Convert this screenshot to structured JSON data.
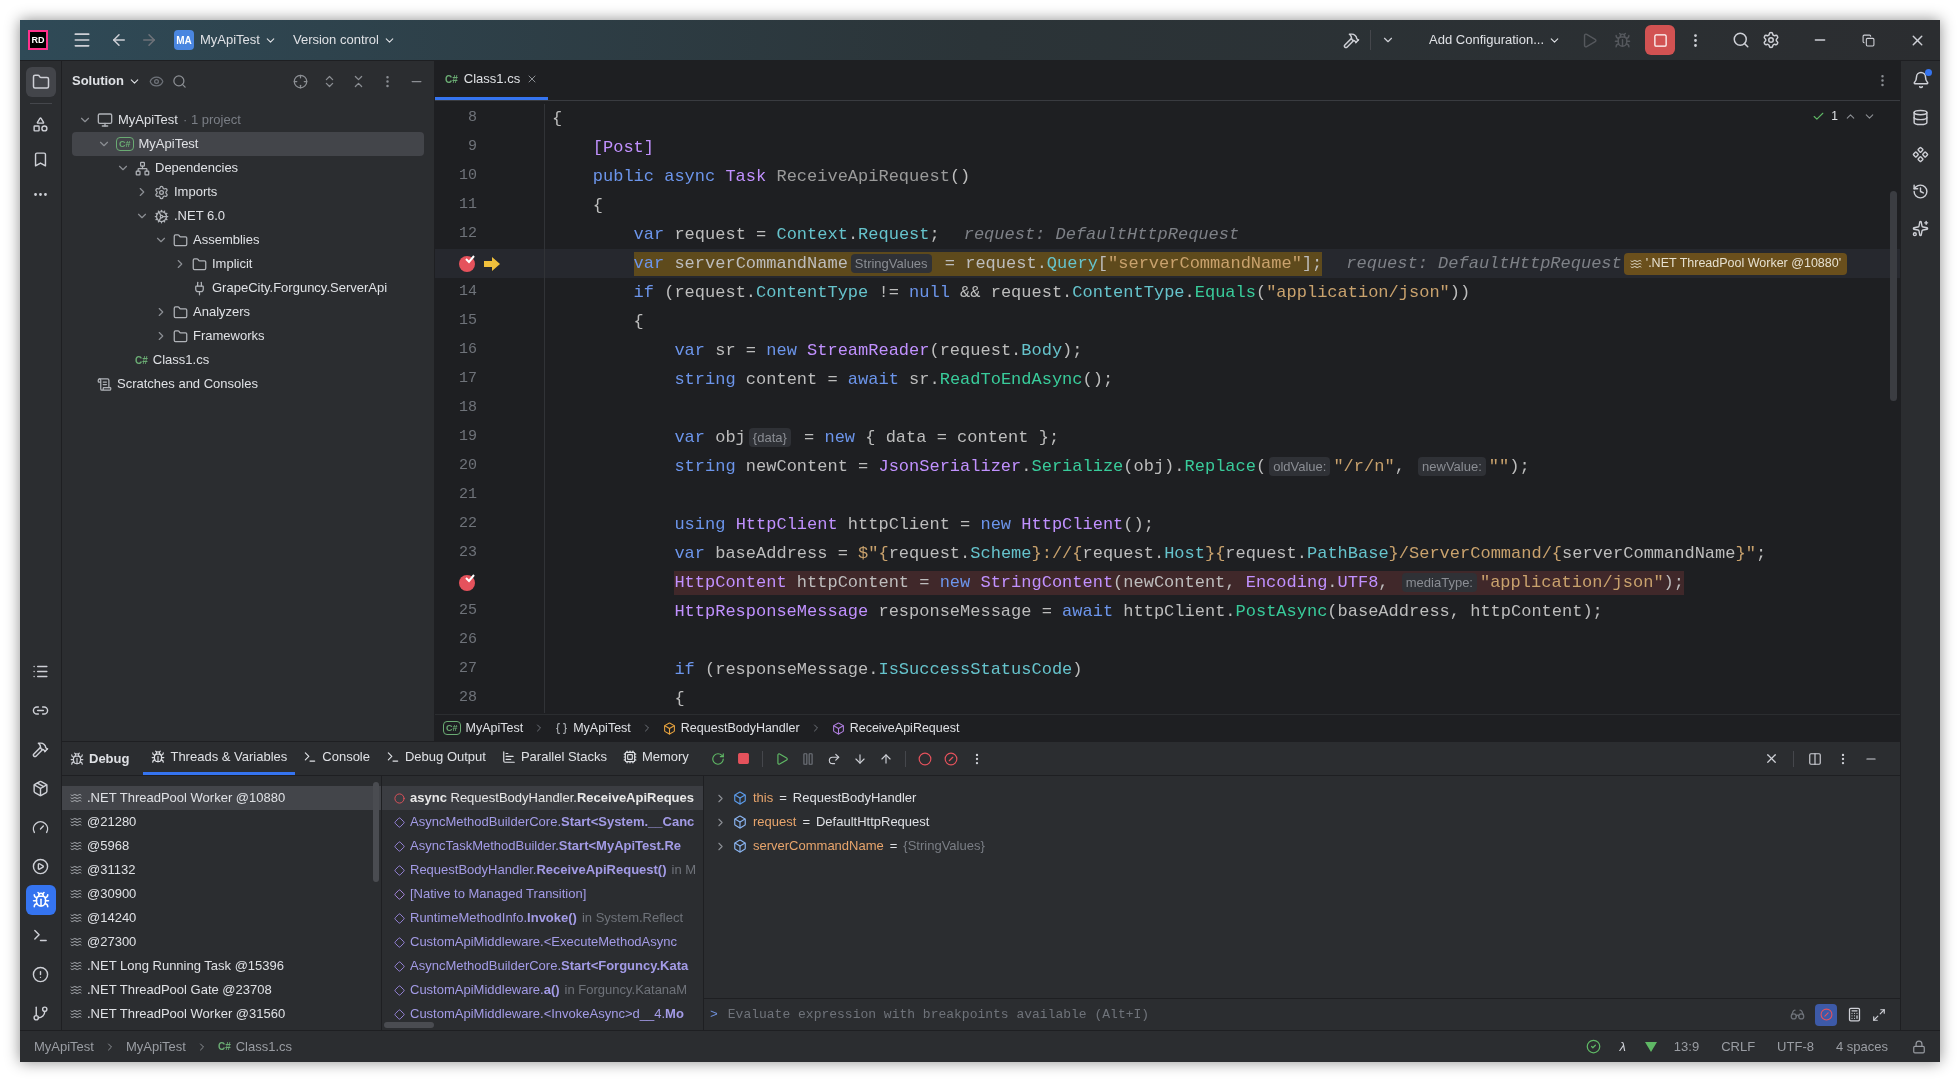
{
  "title_bar": {
    "logo": "RD",
    "project_badge": "MA",
    "project": "MyApiTest",
    "vcs": "Version control",
    "run_config": "Add Configuration...",
    "run_enabled": false,
    "debug_enabled": false,
    "stop_enabled": true
  },
  "solution": {
    "title": "Solution",
    "tree": [
      {
        "label": "MyApiTest",
        "kind": "solution",
        "note": "· 1 project",
        "expanded": true,
        "selected": false,
        "children": [
          {
            "label": "MyApiTest",
            "badge": "C#",
            "kind": "project",
            "expanded": true,
            "selected": true,
            "children": [
              {
                "label": "Dependencies",
                "kind": "dependencies",
                "expanded": true,
                "selected": false,
                "children": [
                  {
                    "label": "Imports",
                    "kind": "imports",
                    "expanded": false,
                    "selected": false
                  },
                  {
                    "label": ".NET 6.0",
                    "kind": "framework",
                    "expanded": true,
                    "selected": false,
                    "children": [
                      {
                        "label": "Assemblies",
                        "kind": "folder",
                        "expanded": true,
                        "selected": false,
                        "children": [
                          {
                            "label": "Implicit",
                            "kind": "folder",
                            "expanded": false,
                            "selected": false
                          },
                          {
                            "label": "GrapeCity.Forguncy.ServerApi",
                            "kind": "reference",
                            "selected": false
                          }
                        ]
                      },
                      {
                        "label": "Analyzers",
                        "kind": "folder",
                        "expanded": false,
                        "selected": false
                      },
                      {
                        "label": "Frameworks",
                        "kind": "folder",
                        "expanded": false,
                        "selected": false
                      }
                    ]
                  }
                ]
              },
              {
                "label": "Class1.cs",
                "badge": "C#",
                "kind": "file",
                "selected": false
              }
            ]
          }
        ]
      },
      {
        "label": "Scratches and Consoles",
        "kind": "scratches",
        "selected": false
      }
    ]
  },
  "editor": {
    "tabs": [
      {
        "badge": "C#",
        "label": "Class1.cs",
        "selected": true
      }
    ],
    "inspections": "1",
    "lines": [
      {
        "number": "8",
        "breakpoint": false,
        "current": false,
        "tokens": [
          {
            "t": "{",
            "kind": "plain"
          }
        ],
        "children": [
          {
            "number": "9",
            "breakpoint": false,
            "current": false,
            "tokens": [
              {
                "t": "[Post]",
                "kind": "type"
              }
            ]
          },
          {
            "number": "10",
            "breakpoint": false,
            "current": false,
            "tokens": [
              {
                "t": "public async ",
                "kind": "kw"
              },
              {
                "t": "Task ",
                "kind": "type"
              },
              {
                "t": "ReceiveApiRequest",
                "kind": "dim"
              },
              {
                "t": "()",
                "kind": "plain"
              }
            ]
          },
          {
            "number": "11",
            "breakpoint": false,
            "current": false,
            "tokens": [
              {
                "t": "{",
                "kind": "plain"
              }
            ],
            "children": [
              {
                "number": "12",
                "breakpoint": false,
                "current": false,
                "value": "request: DefaultHttpRequest",
                "tokens": [
                  {
                    "t": "var ",
                    "kind": "kw"
                  },
                  {
                    "t": "request = ",
                    "kind": "plain"
                  },
                  {
                    "t": "Context",
                    "kind": "prop"
                  },
                  {
                    "t": ".",
                    "kind": "plain"
                  },
                  {
                    "t": "Request",
                    "kind": "prop"
                  },
                  {
                    "t": ";",
                    "kind": "plain"
                  }
                ]
              },
              {
                "breakpoint": true,
                "current": true,
                "value": "request: DefaultHttpRequest",
                "thread": "'.NET ThreadPool Worker @10880'",
                "tokens": [
                  {
                    "t": "var ",
                    "kind": "kw"
                  },
                  {
                    "t": "serverCommandName",
                    "kind": "plain"
                  },
                  {
                    "t": "StringValues",
                    "kind": "hint"
                  },
                  {
                    "t": " = request.",
                    "kind": "plain"
                  },
                  {
                    "t": "Query",
                    "kind": "prop"
                  },
                  {
                    "t": "[",
                    "kind": "plain"
                  },
                  {
                    "t": "\"serverCommandName\"",
                    "kind": "str"
                  },
                  {
                    "t": "];",
                    "kind": "plain"
                  }
                ]
              },
              {
                "number": "14",
                "breakpoint": false,
                "current": false,
                "tokens": [
                  {
                    "t": "if ",
                    "kind": "kw"
                  },
                  {
                    "t": "(request.",
                    "kind": "plain"
                  },
                  {
                    "t": "ContentType",
                    "kind": "prop"
                  },
                  {
                    "t": " != ",
                    "kind": "plain"
                  },
                  {
                    "t": "null",
                    "kind": "kw"
                  },
                  {
                    "t": " && request.",
                    "kind": "plain"
                  },
                  {
                    "t": "ContentType",
                    "kind": "prop"
                  },
                  {
                    "t": ".",
                    "kind": "plain"
                  },
                  {
                    "t": "Equals",
                    "kind": "method"
                  },
                  {
                    "t": "(",
                    "kind": "plain"
                  },
                  {
                    "t": "\"application/json\"",
                    "kind": "str"
                  },
                  {
                    "t": "))",
                    "kind": "plain"
                  }
                ]
              },
              {
                "number": "15",
                "breakpoint": false,
                "current": false,
                "tokens": [
                  {
                    "t": "{",
                    "kind": "plain"
                  }
                ],
                "children": [
                  {
                    "number": "16",
                    "breakpoint": false,
                    "current": false,
                    "tokens": [
                      {
                        "t": "var ",
                        "kind": "kw"
                      },
                      {
                        "t": "sr = ",
                        "kind": "plain"
                      },
                      {
                        "t": "new ",
                        "kind": "kw"
                      },
                      {
                        "t": "StreamReader",
                        "kind": "type"
                      },
                      {
                        "t": "(request.",
                        "kind": "plain"
                      },
                      {
                        "t": "Body",
                        "kind": "prop"
                      },
                      {
                        "t": ");",
                        "kind": "plain"
                      }
                    ]
                  },
                  {
                    "number": "17",
                    "breakpoint": false,
                    "current": false,
                    "tokens": [
                      {
                        "t": "string ",
                        "kind": "kw"
                      },
                      {
                        "t": "content = ",
                        "kind": "plain"
                      },
                      {
                        "t": "await ",
                        "kind": "kw"
                      },
                      {
                        "t": "sr.",
                        "kind": "plain"
                      },
                      {
                        "t": "ReadToEndAsync",
                        "kind": "method"
                      },
                      {
                        "t": "();",
                        "kind": "plain"
                      }
                    ]
                  },
                  {
                    "number": "18",
                    "breakpoint": false,
                    "current": false
                  },
                  {
                    "number": "19",
                    "breakpoint": false,
                    "current": false,
                    "tokens": [
                      {
                        "t": "var ",
                        "kind": "kw"
                      },
                      {
                        "t": "obj",
                        "kind": "plain"
                      },
                      {
                        "t": "{data}",
                        "kind": "hint"
                      },
                      {
                        "t": " = ",
                        "kind": "plain"
                      },
                      {
                        "t": "new ",
                        "kind": "kw"
                      },
                      {
                        "t": "{ data = content };",
                        "kind": "plain"
                      }
                    ]
                  },
                  {
                    "number": "20",
                    "breakpoint": false,
                    "current": false,
                    "tokens": [
                      {
                        "t": "string ",
                        "kind": "kw"
                      },
                      {
                        "t": "newContent = ",
                        "kind": "plain"
                      },
                      {
                        "t": "JsonSerializer",
                        "kind": "type"
                      },
                      {
                        "t": ".",
                        "kind": "plain"
                      },
                      {
                        "t": "Serialize",
                        "kind": "method"
                      },
                      {
                        "t": "(obj).",
                        "kind": "plain"
                      },
                      {
                        "t": "Replace",
                        "kind": "method"
                      },
                      {
                        "t": "(",
                        "kind": "plain"
                      },
                      {
                        "t": "oldValue:",
                        "kind": "hint"
                      },
                      {
                        "t": "\"/r/n\"",
                        "kind": "str"
                      },
                      {
                        "t": ", ",
                        "kind": "plain"
                      },
                      {
                        "t": "newValue:",
                        "kind": "hint"
                      },
                      {
                        "t": "\"\"",
                        "kind": "str"
                      },
                      {
                        "t": ");",
                        "kind": "plain"
                      }
                    ]
                  },
                  {
                    "number": "21",
                    "breakpoint": false,
                    "current": false
                  },
                  {
                    "number": "22",
                    "breakpoint": false,
                    "current": false,
                    "tokens": [
                      {
                        "t": "using ",
                        "kind": "kw"
                      },
                      {
                        "t": "HttpClient ",
                        "kind": "type"
                      },
                      {
                        "t": "httpClient = ",
                        "kind": "plain"
                      },
                      {
                        "t": "new ",
                        "kind": "kw"
                      },
                      {
                        "t": "HttpClient",
                        "kind": "type"
                      },
                      {
                        "t": "();",
                        "kind": "plain"
                      }
                    ]
                  },
                  {
                    "number": "23",
                    "breakpoint": false,
                    "current": false,
                    "tokens": [
                      {
                        "t": "var ",
                        "kind": "kw"
                      },
                      {
                        "t": "baseAddress = ",
                        "kind": "plain"
                      },
                      {
                        "t": "$\"{",
                        "kind": "str"
                      },
                      {
                        "t": "request.",
                        "kind": "plain"
                      },
                      {
                        "t": "Scheme",
                        "kind": "prop"
                      },
                      {
                        "t": "}://{",
                        "kind": "str"
                      },
                      {
                        "t": "request.",
                        "kind": "plain"
                      },
                      {
                        "t": "Host",
                        "kind": "prop"
                      },
                      {
                        "t": "}{",
                        "kind": "str"
                      },
                      {
                        "t": "request.",
                        "kind": "plain"
                      },
                      {
                        "t": "PathBase",
                        "kind": "prop"
                      },
                      {
                        "t": "}/ServerCommand/{",
                        "kind": "str"
                      },
                      {
                        "t": "serverCommandName",
                        "kind": "plain"
                      },
                      {
                        "t": "}\"",
                        "kind": "str"
                      },
                      {
                        "t": ";",
                        "kind": "plain"
                      }
                    ]
                  },
                  {
                    "breakpoint": true,
                    "current": false,
                    "tokens": [
                      {
                        "t": "HttpContent ",
                        "kind": "type"
                      },
                      {
                        "t": "httpContent = ",
                        "kind": "plain"
                      },
                      {
                        "t": "new ",
                        "kind": "kw"
                      },
                      {
                        "t": "StringContent",
                        "kind": "type"
                      },
                      {
                        "t": "(newContent, ",
                        "kind": "plain"
                      },
                      {
                        "t": "Encoding",
                        "kind": "type"
                      },
                      {
                        "t": ".",
                        "kind": "plain"
                      },
                      {
                        "t": "UTF8",
                        "kind": "type"
                      },
                      {
                        "t": ", ",
                        "kind": "plain"
                      },
                      {
                        "t": "mediaType:",
                        "kind": "hint"
                      },
                      {
                        "t": "\"application/json\"",
                        "kind": "str"
                      },
                      {
                        "t": ");",
                        "kind": "plain"
                      }
                    ]
                  },
                  {
                    "number": "25",
                    "breakpoint": false,
                    "current": false,
                    "tokens": [
                      {
                        "t": "HttpResponseMessage ",
                        "kind": "type"
                      },
                      {
                        "t": "responseMessage = ",
                        "kind": "plain"
                      },
                      {
                        "t": "await ",
                        "kind": "kw"
                      },
                      {
                        "t": "httpClient.",
                        "kind": "plain"
                      },
                      {
                        "t": "PostAsync",
                        "kind": "method"
                      },
                      {
                        "t": "(baseAddress, httpContent);",
                        "kind": "plain"
                      }
                    ]
                  },
                  {
                    "number": "26",
                    "breakpoint": false,
                    "current": false
                  },
                  {
                    "number": "27",
                    "breakpoint": false,
                    "current": false,
                    "tokens": [
                      {
                        "t": "if ",
                        "kind": "kw"
                      },
                      {
                        "t": "(responseMessage.",
                        "kind": "plain"
                      },
                      {
                        "t": "IsSuccessStatusCode",
                        "kind": "prop"
                      },
                      {
                        "t": ")",
                        "kind": "plain"
                      }
                    ]
                  },
                  {
                    "number": "28",
                    "breakpoint": false,
                    "current": false,
                    "tokens": [
                      {
                        "t": "{",
                        "kind": "plain"
                      }
                    ]
                  }
                ]
              }
            ]
          }
        ]
      }
    ],
    "breadcrumbs": [
      {
        "kind": "project",
        "badge": "C#",
        "label": "MyApiTest"
      },
      {
        "kind": "namespace",
        "label": "MyApiTest"
      },
      {
        "kind": "class",
        "label": "RequestBodyHandler"
      },
      {
        "kind": "method",
        "label": "ReceiveApiRequest"
      }
    ]
  },
  "debug": {
    "title": "Debug",
    "tabs": [
      {
        "label": "Threads & Variables",
        "kind": "bug",
        "selected": true
      },
      {
        "label": "Console",
        "kind": "console",
        "selected": false
      },
      {
        "label": "Debug Output",
        "kind": "console",
        "selected": false
      },
      {
        "label": "Parallel Stacks",
        "kind": "stacks",
        "selected": false
      },
      {
        "label": "Memory",
        "kind": "memory",
        "selected": false
      }
    ],
    "threads": [
      {
        "label": ".NET ThreadPool Worker @10880",
        "selected": true
      },
      {
        "label": "@21280",
        "selected": false
      },
      {
        "label": "@5968",
        "selected": false
      },
      {
        "label": "@31132",
        "selected": false
      },
      {
        "label": "@30900",
        "selected": false
      },
      {
        "label": "@14240",
        "selected": false
      },
      {
        "label": "@27300",
        "selected": false
      },
      {
        "label": ".NET Long Running Task @15396",
        "selected": false
      },
      {
        "label": ".NET ThreadPool Gate @23708",
        "selected": false
      },
      {
        "label": ".NET ThreadPool Worker @31560",
        "selected": false
      }
    ],
    "frames": [
      {
        "kind": "current",
        "text": "**async** RequestBodyHandler.**ReceiveApiReques**",
        "selected": true
      },
      {
        "kind": "frame",
        "text": "AsyncMethodBuilderCore.**Start<System.__Canc**",
        "selected": false
      },
      {
        "kind": "frame",
        "text": "AsyncTaskMethodBuilder.**Start<MyApiTest.Re**",
        "selected": false
      },
      {
        "kind": "frame",
        "text": "RequestBodyHandler.**ReceiveApiRequest()**",
        "location": "in M",
        "selected": false
      },
      {
        "kind": "native",
        "text": "[Native to Managed Transition]",
        "selected": false
      },
      {
        "kind": "frame",
        "text": "RuntimeMethodInfo.**Invoke()**",
        "location": "in System.Reflect",
        "selected": false
      },
      {
        "kind": "frame",
        "text": "CustomApiMiddleware.<ExecuteMethodAsync",
        "selected": false
      },
      {
        "kind": "frame",
        "text": "AsyncMethodBuilderCore.**Start<Forguncy.Kata**",
        "selected": false
      },
      {
        "kind": "frame",
        "text": "CustomApiMiddleware.**a()**",
        "location": "in Forguncy.KatanaM",
        "selected": false
      },
      {
        "kind": "frame",
        "text": "CustomApiMiddleware.<InvokeAsync>d__4.**Mo**",
        "selected": false
      }
    ],
    "variables": [
      {
        "kind": "this",
        "name": "this",
        "sign": "=",
        "value": "RequestBodyHandler",
        "dimmed": false
      },
      {
        "kind": "local",
        "name": "request",
        "sign": "=",
        "value": "DefaultHttpRequest",
        "dimmed": false
      },
      {
        "kind": "local",
        "name": "serverCommandName",
        "sign": "=",
        "value": "{StringValues}",
        "dimmed": true
      }
    ],
    "evaluate": {
      "prompt": ">",
      "placeholder": "Evaluate expression with breakpoints available (Alt+I)"
    }
  },
  "status_bar": {
    "breadcrumbs": [
      {
        "label": "MyApiTest"
      },
      {
        "label": "MyApiTest"
      },
      {
        "badge": "C#",
        "label": "Class1.cs"
      }
    ],
    "plugin": "λ",
    "position": "13:9",
    "line_ending": "CRLF",
    "encoding": "UTF-8",
    "indent": "4 spaces"
  }
}
